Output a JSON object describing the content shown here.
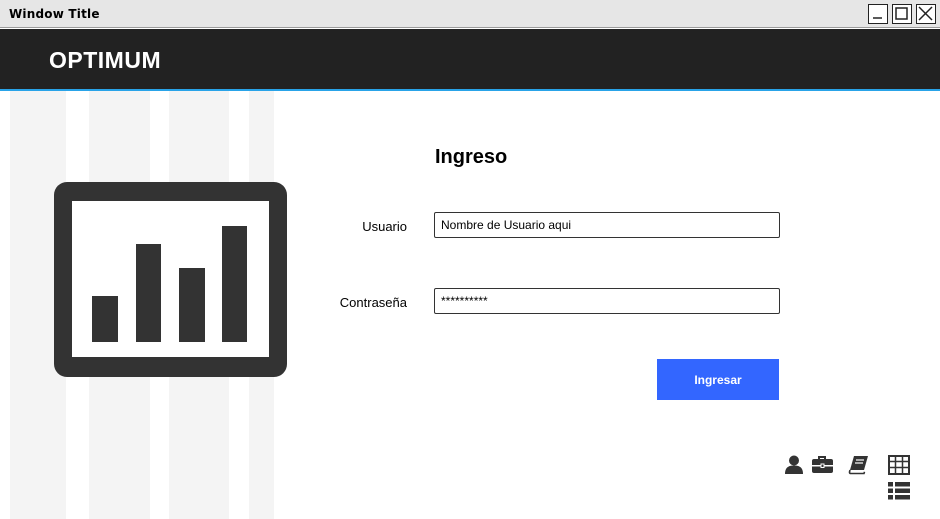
{
  "window": {
    "title": "Window Title",
    "controls": [
      "minimize",
      "maximize",
      "close"
    ]
  },
  "header": {
    "brand": "OPTIMUM",
    "accent_color": "#29a3e8"
  },
  "hero": {
    "icon": "bar-chart-icon"
  },
  "login": {
    "title": "Ingreso",
    "username": {
      "label": "Usuario",
      "value": "Nombre de Usuario aqui"
    },
    "password": {
      "label": "Contraseña",
      "value": "**********"
    },
    "submit_label": "Ingresar",
    "submit_color": "#3366ff"
  },
  "footer_icons": [
    "user-icon",
    "briefcase-icon",
    "book-icon",
    "table-icon",
    "list-icon"
  ]
}
